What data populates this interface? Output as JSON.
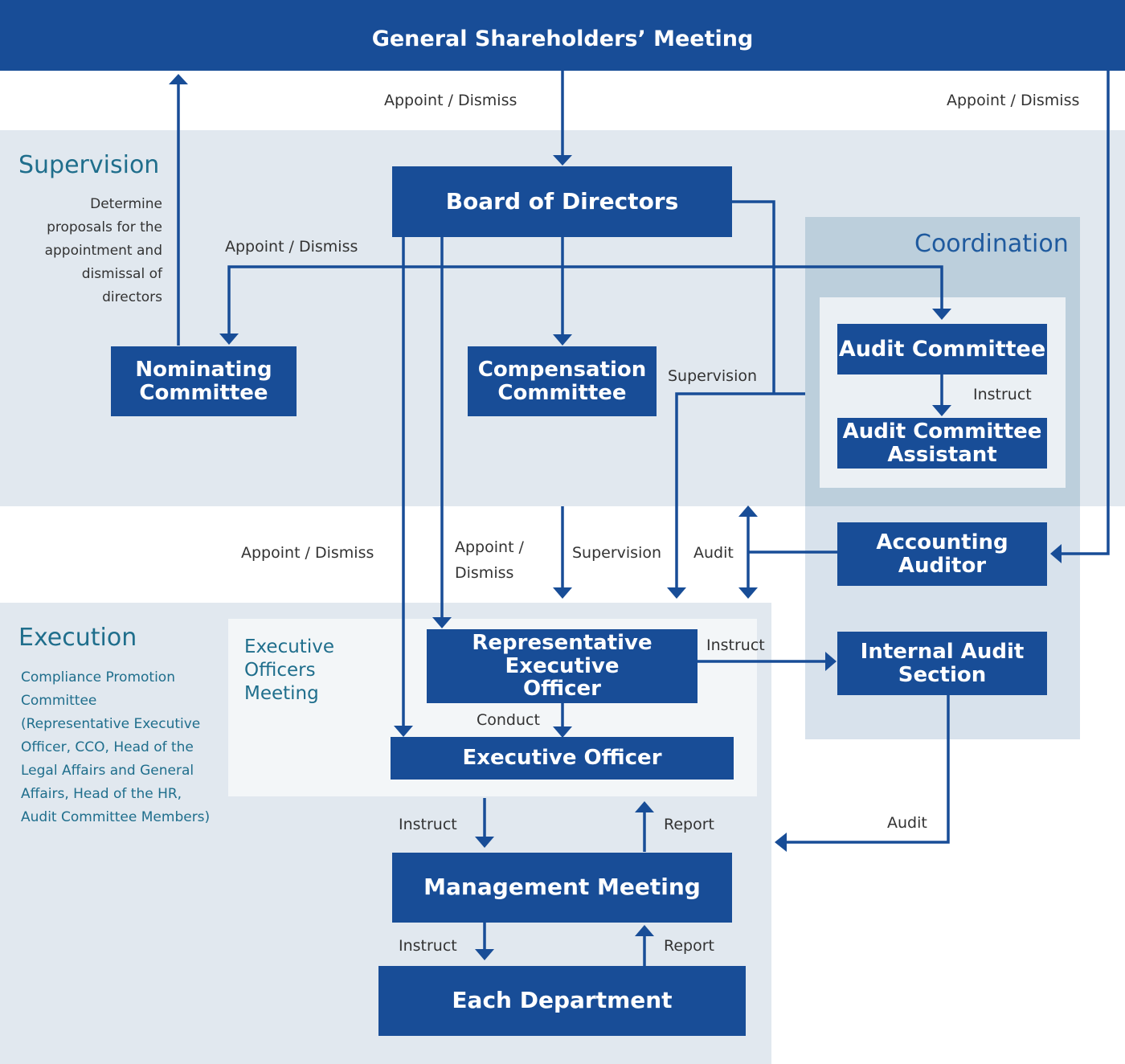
{
  "colors": {
    "primary": "#184d97",
    "band": "#e1e8ef",
    "coordination": "#bccfdc",
    "coordination_lower": "#d8e2ec",
    "inner": "#ebf0f4",
    "section_text": "#1f6e8c"
  },
  "header": {
    "title": "General Shareholders’ Meeting"
  },
  "sections": {
    "supervision": "Supervision",
    "coordination": "Coordination",
    "execution": "Execution",
    "executive_officers_meeting": "Executive Officers Meeting"
  },
  "notes": {
    "nominating": [
      "Determine",
      "proposals for the",
      "appointment and",
      "dismissal of",
      "directors"
    ],
    "compliance": [
      "Compliance Promotion",
      "Committee",
      "(Representative Executive",
      "Officer, CCO, Head of the",
      "Legal Affairs and General",
      "Affairs, Head of the HR,",
      "Audit Committee Members)"
    ]
  },
  "boxes": {
    "board": "Board of Directors",
    "nominating": [
      "Nominating",
      "Committee"
    ],
    "compensation": [
      "Compensation",
      "Committee"
    ],
    "audit_committee": "Audit Committee",
    "audit_assistant": [
      "Audit Committee",
      "Assistant"
    ],
    "accounting_auditor": [
      "Accounting",
      "Auditor"
    ],
    "internal_audit": [
      "Internal Audit",
      "Section"
    ],
    "rep_exec": [
      "Representative",
      "Executive",
      "Officer"
    ],
    "exec_officer": "Executive Officer",
    "management": "Management Meeting",
    "department": "Each Department"
  },
  "labels": {
    "gsm_board": "Appoint / Dismiss",
    "gsm_auditor": "Appoint / Dismiss",
    "board_committees": "Appoint / Dismiss",
    "supervision_right": "Supervision",
    "instruct_assistant": "Instruct",
    "appoint_exec": "Appoint / Dismiss",
    "appoint_rep": [
      "Appoint /",
      "Dismiss"
    ],
    "supervision_exec": "Supervision",
    "audit_auditor": "Audit",
    "instruct_internal": "Instruct",
    "conduct": "Conduct",
    "instruct_mgmt": "Instruct",
    "report_mgmt": "Report",
    "instruct_dept": "Instruct",
    "report_dept": "Report",
    "audit_internal": "Audit"
  }
}
